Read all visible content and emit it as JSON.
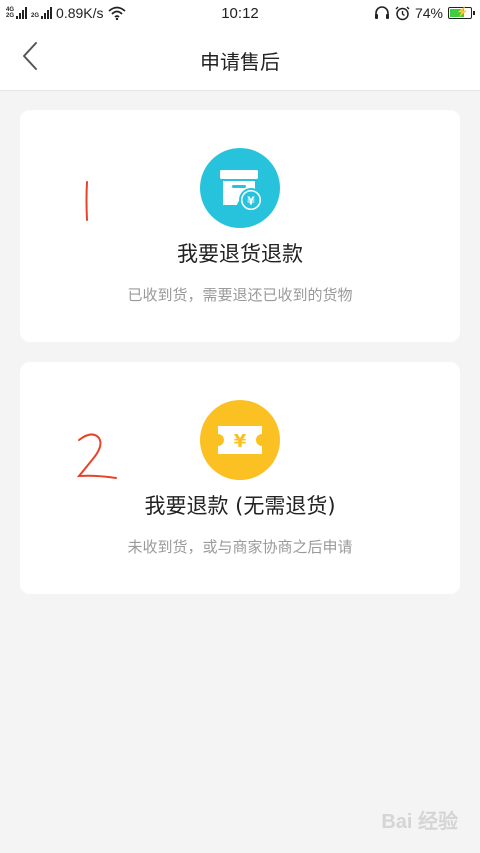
{
  "status_bar": {
    "network_speed": "0.89K/s",
    "time": "10:12",
    "battery_percent": "74%",
    "battery_level": 0.74,
    "net_labels": [
      "4G",
      "2G"
    ],
    "net_labels_2": "2G"
  },
  "header": {
    "title": "申请售后",
    "back_icon": "chevron-left-icon"
  },
  "options": [
    {
      "title": "我要退货退款",
      "description": "已收到货，需要退还已收到的货物",
      "icon": "return-box-icon",
      "color": "#27c3dc",
      "annotation": "1"
    },
    {
      "title": "我要退款 (无需退货)",
      "description": "未收到货，或与商家协商之后申请",
      "icon": "refund-ticket-icon",
      "color": "#fbc021",
      "annotation": "2"
    }
  ],
  "colors": {
    "annotation": "#e8432a"
  },
  "watermark": "Bai 经验"
}
